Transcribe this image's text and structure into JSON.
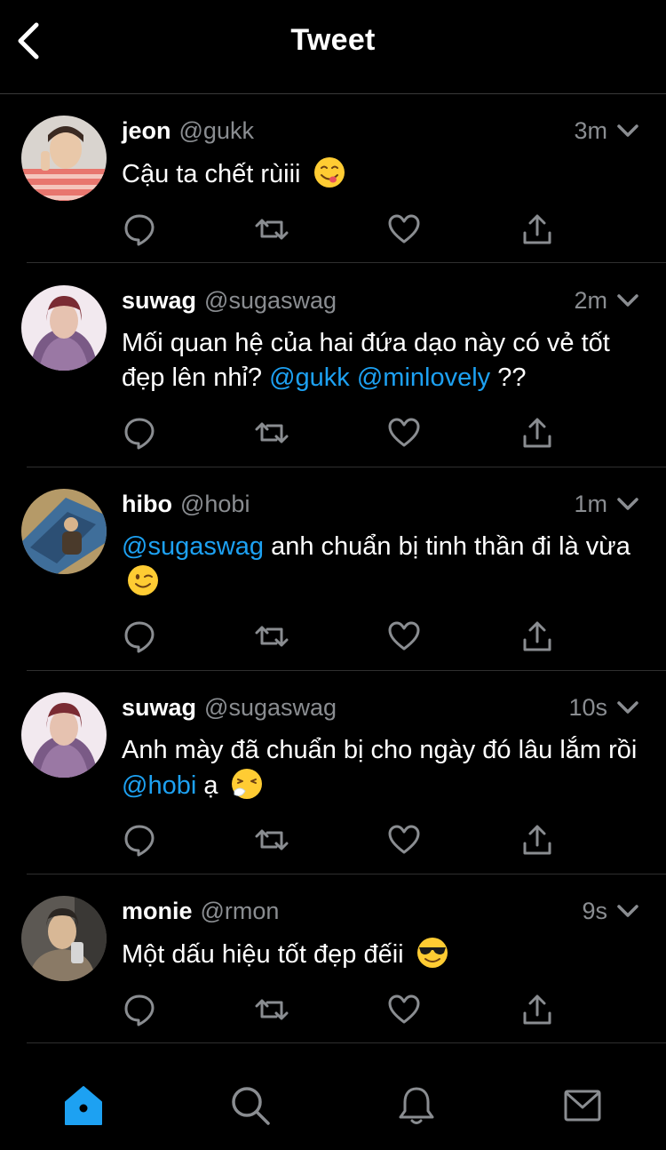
{
  "header": {
    "title": "Tweet"
  },
  "tweets": [
    {
      "name": "jeon",
      "handle": "@gukk",
      "time": "3m",
      "text_parts": [
        "Cậu ta chết rùiii"
      ],
      "emoji": "yum-face-icon"
    },
    {
      "name": "suwag",
      "handle": "@sugaswag",
      "time": "2m",
      "text_parts": [
        "Mối quan hệ của hai đứa dạo này có vẻ tốt đẹp lên nhỉ?",
        "@gukk",
        "@minlovely",
        "??"
      ]
    },
    {
      "name": "hibo",
      "handle": "@hobi",
      "time": "1m",
      "text_parts": [
        "@sugaswag",
        "anh chuẩn bị tinh thần đi là vừa"
      ],
      "emoji": "wink-face-icon"
    },
    {
      "name": "suwag",
      "handle": "@sugaswag",
      "time": "10s",
      "text_parts": [
        "Anh mày đã chuẩn bị cho ngày đó lâu lắm rồi",
        "@hobi",
        "ạ"
      ],
      "emoji": "sneezing-face-icon"
    },
    {
      "name": "monie",
      "handle": "@rmon",
      "time": "9s",
      "text_parts": [
        "Một dấu hiệu tốt đẹp đếii"
      ],
      "emoji": "sunglasses-face-icon"
    }
  ],
  "actions": [
    "reply-icon",
    "retweet-icon",
    "like-icon",
    "share-icon"
  ],
  "bottom_nav": [
    "home-icon",
    "search-icon",
    "notifications-icon",
    "messages-icon"
  ],
  "colors": {
    "background": "#000000",
    "accent": "#1da1f2",
    "secondary_text": "#8a8d91",
    "divider": "#2f2f2f"
  }
}
